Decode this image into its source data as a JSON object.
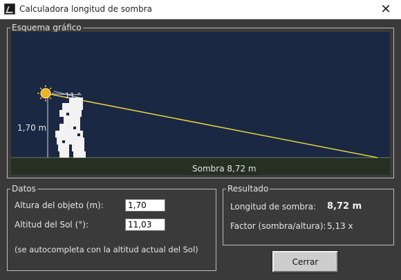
{
  "window": {
    "title": "Calculadora longitud de sombra",
    "close_glyph": "✕"
  },
  "scheme": {
    "legend": "Esquema gráfico",
    "height_label": "1,70 m",
    "angle_label": "11 °",
    "shadow_label": "Sombra 8,72 m",
    "colors": {
      "sky": "#1b2844",
      "ground": "#252f22",
      "sun": "#f0b11f",
      "ray": "#e9d63b"
    }
  },
  "data": {
    "legend": "Datos",
    "height_label": "Altura del objeto (m):",
    "height_value": "1,70",
    "altitude_label": "Altitud del Sol (°):",
    "altitude_value": "11,03",
    "note": "(se autocompleta con la altitud actual del Sol)"
  },
  "result": {
    "legend": "Resultado",
    "shadow_label": "Longitud de sombra:",
    "shadow_value": "8,72 m",
    "factor_label": "Factor (sombra/altura):",
    "factor_value": "5,13 x"
  },
  "buttons": {
    "close": "Cerrar"
  }
}
